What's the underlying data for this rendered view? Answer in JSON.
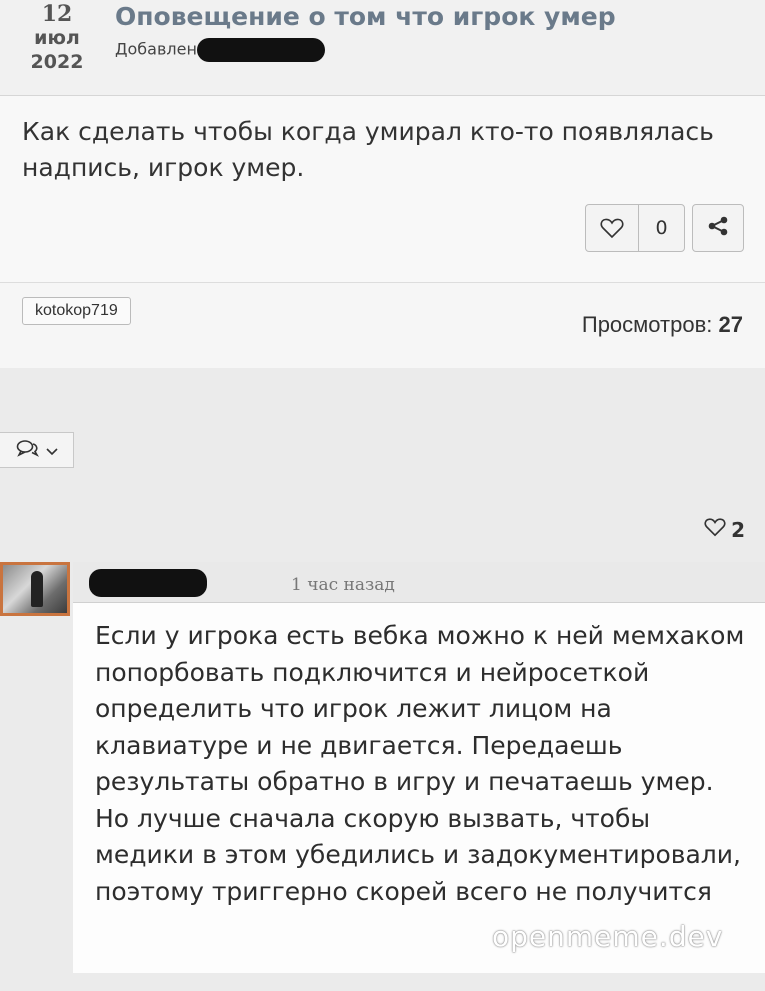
{
  "topic": {
    "date_day": "12",
    "date_month": "июл",
    "date_year": "2022",
    "title": "Оповещение о том что игрок умер",
    "added_label": "Добавлен"
  },
  "post": {
    "text": "Как сделать чтобы когда умирал кто-то появлялась надпись, игрок умер.",
    "like_count": "0"
  },
  "meta": {
    "tag": "kotokop719",
    "views_label": "Просмотров:",
    "views_count": "27"
  },
  "comments": {
    "likes_count": "2",
    "items": [
      {
        "time": "1 час назад",
        "text": "Если у игрока есть вебка можно к ней мемхаком попорбовать подключится и нейросеткой определить что игрок лежит лицом на клавиатуре и не двигается. Передаешь результаты обратно в игру и печатаешь умер. Но лучше сначала скорую вызвать, чтобы медики в этом убедились и задокументировали, поэтому триггерно скорей всего не получится"
      }
    ]
  },
  "watermark": "openmeme.dev",
  "icons": {
    "like": "heart-icon",
    "share": "share-icon",
    "comments_toggle": "comments-icon",
    "dropdown": "chevron-down-icon"
  }
}
